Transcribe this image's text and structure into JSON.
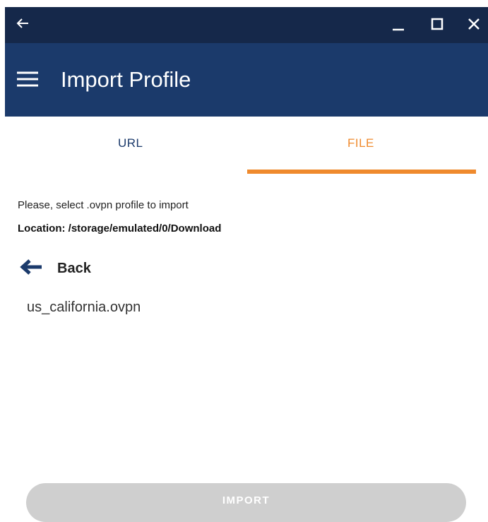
{
  "window": {
    "controls": [
      "back-arrow-icon",
      "minimize-icon",
      "maximize-icon",
      "close-icon"
    ]
  },
  "appbar": {
    "title": "Import Profile",
    "icon": "hamburger-menu-icon"
  },
  "tabs": [
    {
      "label": "URL",
      "active": false
    },
    {
      "label": "FILE",
      "active": true
    }
  ],
  "content": {
    "instruction": "Please, select .ovpn profile to import",
    "location": "Location: /storage/emulated/0/Download",
    "back_label": "Back",
    "files": [
      "us_california.ovpn"
    ]
  },
  "footer": {
    "import_label": "IMPORT",
    "import_enabled": false
  },
  "colors": {
    "titlebar": "#15284a",
    "appbar": "#1b3a6b",
    "accent": "#ef8a2d",
    "disabled_button": "#cfcfcf"
  }
}
